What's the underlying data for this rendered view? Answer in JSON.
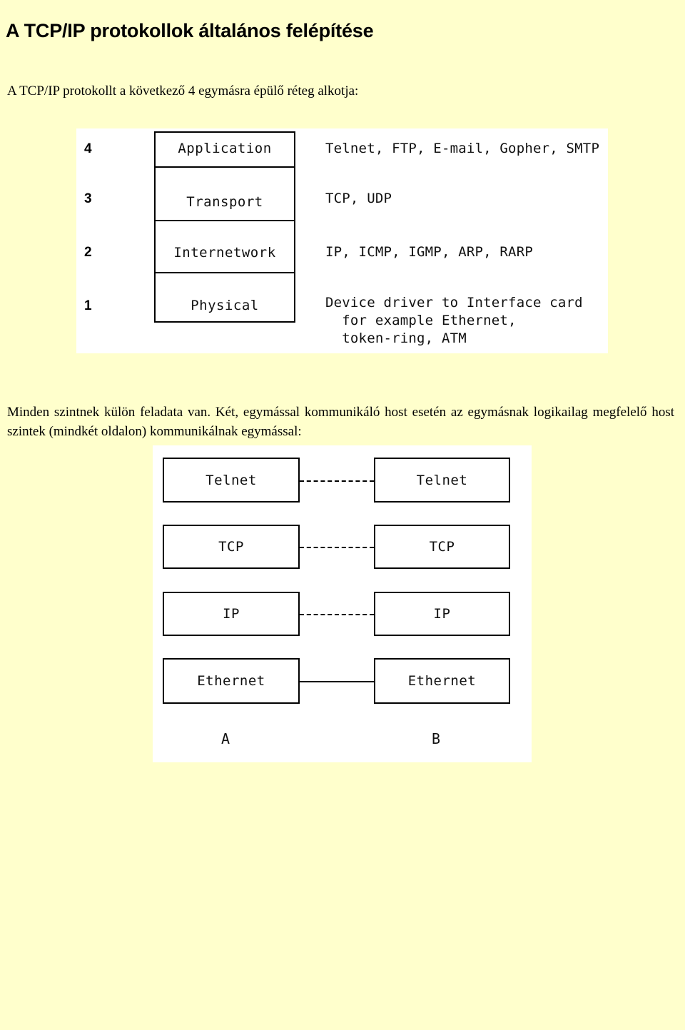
{
  "page": {
    "background_color": "#FFFFCC",
    "canvas_color": "#FFFFFF"
  },
  "heading": {
    "title": "A TCP/IP protokollok általános felépítése"
  },
  "intro": {
    "text": "A TCP/IP protokollt a következő 4  egymásra épülő réteg alkotja:"
  },
  "layer_figure": {
    "name": "tcp-ip-layer-stack",
    "layers": [
      {
        "number": "4",
        "name": "Application",
        "protocols": "Telnet, FTP, E-mail, Gopher, SMTP"
      },
      {
        "number": "3",
        "name": "Transport",
        "protocols": "TCP, UDP"
      },
      {
        "number": "2",
        "name": "Internetwork",
        "protocols": "IP, ICMP, IGMP, ARP, RARP"
      },
      {
        "number": "1",
        "name": "Physical",
        "protocols": "Device driver to Interface card\n  for example Ethernet,\n  token-ring, ATM"
      }
    ]
  },
  "mid_text": {
    "text": "Minden szintnek külön feladata van. Két, egymással kommunikáló host esetén az egymásnak logikailag  megfelelő host szintek (mindkét oldalon) kommunikálnak egymással:"
  },
  "peer_figure": {
    "name": "peer-to-peer-communication",
    "rows": [
      {
        "left": "Telnet",
        "right": "Telnet",
        "link": "dashed"
      },
      {
        "left": "TCP",
        "right": "TCP",
        "link": "dashed"
      },
      {
        "left": "IP",
        "right": "IP",
        "link": "dashed"
      },
      {
        "left": "Ethernet",
        "right": "Ethernet",
        "link": "solid"
      }
    ],
    "host_left": "A",
    "host_right": "B"
  }
}
